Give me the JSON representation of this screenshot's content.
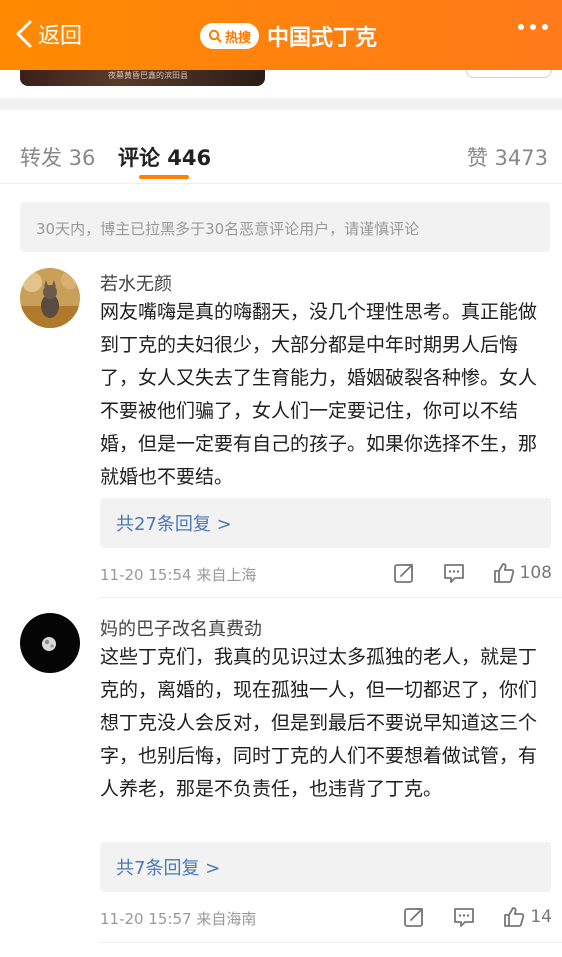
{
  "header": {
    "back_label": "返回",
    "badge": "热搜",
    "title": "中国式丁克",
    "bg_color": "#ff8200"
  },
  "strip": {
    "image_caption": "夜幕黄昏巴鑫的滨田县"
  },
  "tabs": {
    "forward": "转发 36",
    "comment": "评论 446",
    "like": "赞 3473"
  },
  "notice": "30天内，博主已拉黑多于30名恶意评论用户，请谨慎评论",
  "comments": [
    {
      "username": "若水无颜",
      "content": "网友嘴嗨是真的嗨翻天，没几个理性思考。真正能做到丁克的夫妇很少，大部分都是中年时期男人后悔了，女人又失去了生育能力，婚姻破裂各种惨。女人不要被他们骗了，女人们一定要记住，你可以不结婚，但是一定要有自己的孩子。如果你选择不生，那就婚也不要结。",
      "replies": "共27条回复 >",
      "meta": "11-20 15:54  来自上海",
      "likes": "108"
    },
    {
      "username": "妈的巴子改名真费劲",
      "content": "这些丁克们，我真的见识过太多孤独的老人，就是丁克的，离婚的，现在孤独一人，但一切都迟了，你们想丁克没人会反对，但是到最后不要说早知道这三个字，也别后悔，同时丁克的人们不要想着做试管，有人养老，那是不负责任，也违背了丁克。",
      "replies": "共7条回复 >",
      "meta": "11-20 15:57  来自海南",
      "likes": "14"
    }
  ]
}
